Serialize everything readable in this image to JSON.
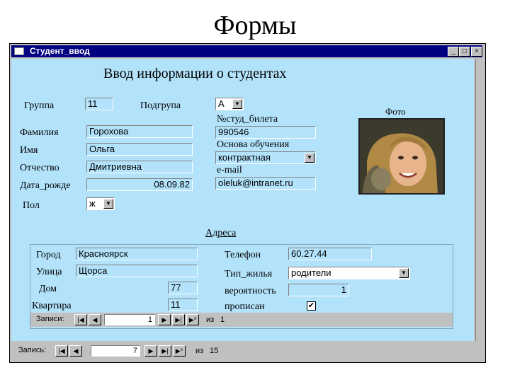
{
  "slide": {
    "title": "Формы"
  },
  "window": {
    "title": "Студент_ввод",
    "buttons": {
      "minimize": "_",
      "maximize": "□",
      "close": "×"
    }
  },
  "form": {
    "heading": "Ввод информации о студентах",
    "labels": {
      "group": "Группа",
      "subgroup": "Подгрупа",
      "student_card": "№студ_билета",
      "surname": "Фамилия",
      "name": "Имя",
      "patronymic": "Отчество",
      "birth_date": "Дата_рожде",
      "study_basis": "Основа обучения",
      "email": "e-mail",
      "sex": "Пол",
      "photo": "Фото",
      "addresses": "Адреса"
    },
    "values": {
      "group": "11",
      "subgroup": "А",
      "student_card": "990546",
      "surname": "Горохова",
      "name": "Ольга",
      "patronymic": "Дмитриевна",
      "birth_date": "08.09.82",
      "study_basis": "контрактная",
      "email": "oleluk@intranet.ru",
      "sex": "ж"
    }
  },
  "address": {
    "labels": {
      "city": "Город",
      "street": "Улица",
      "house": "Дом",
      "flat": "Квартира",
      "phone": "Телефон",
      "housing": "Тип_жилья",
      "probability": "вероятность",
      "registered": "прописан"
    },
    "values": {
      "city": "Красноярск",
      "street": "Щорса",
      "house": "77",
      "flat": "11",
      "phone": "60.27.44",
      "housing": "родители",
      "probability": "1",
      "registered": "✔"
    },
    "nav": {
      "label": "Записи:",
      "current": "1",
      "of_label": "из",
      "total": "1"
    }
  },
  "main_nav": {
    "label": "Запись:",
    "current": "7",
    "of_label": "из",
    "total": "15"
  },
  "nav_glyphs": {
    "first": "|◀",
    "prev": "◀",
    "next": "▶",
    "last": "▶|",
    "new": "▶*"
  },
  "colors": {
    "form_bg": "#b3e3fb",
    "titlebar": "#000080",
    "chrome": "#c0c0c0"
  }
}
